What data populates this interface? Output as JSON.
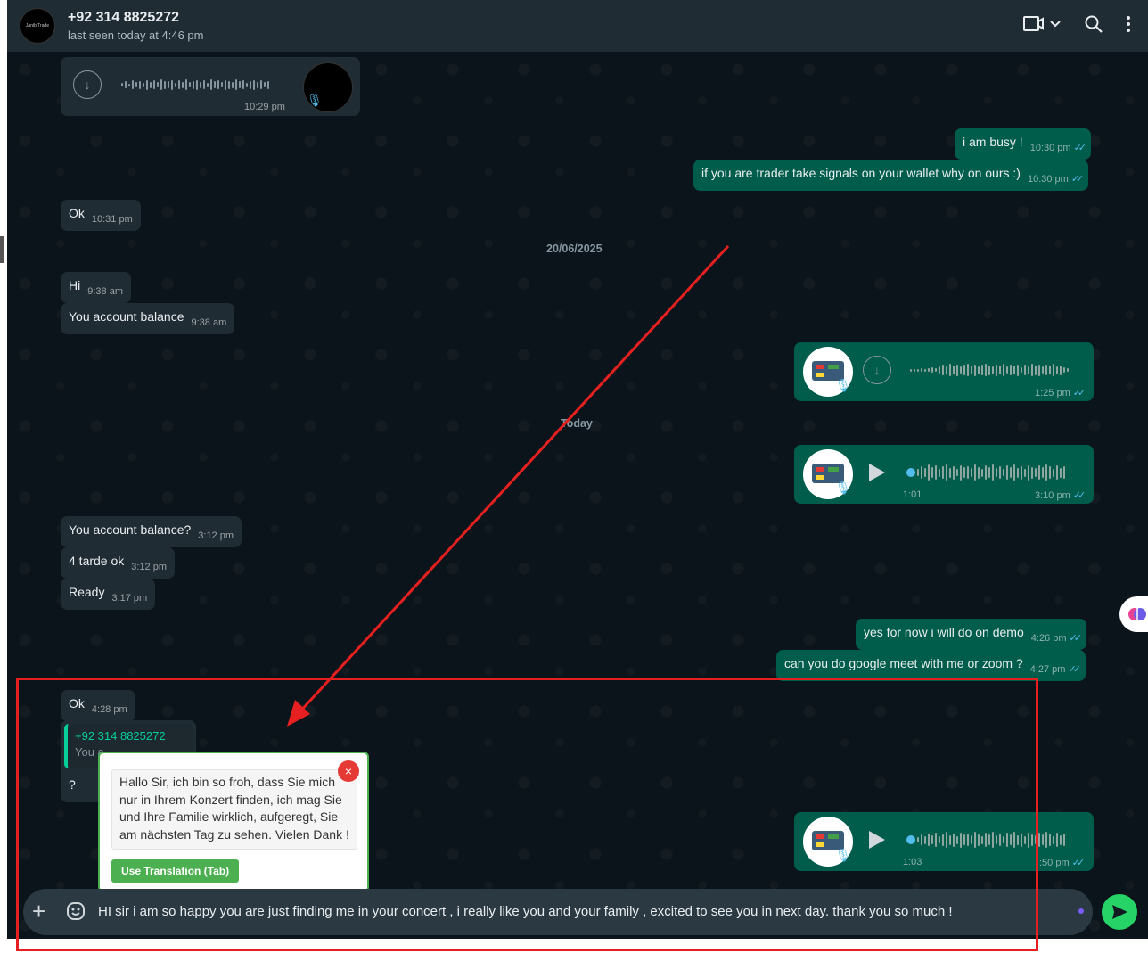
{
  "header": {
    "contact_name": "+92 314 8825272",
    "last_seen": "last seen today at 4:46 pm",
    "avatar_text": "Janib Trade"
  },
  "messages": {
    "voice_in_1": {
      "time": "10:29 pm"
    },
    "out_busy": {
      "text": "i am busy !",
      "time": "10:30 pm"
    },
    "out_trader": {
      "text": "if you are trader take signals on your wallet why on ours :)",
      "time": "10:30 pm"
    },
    "in_ok1": {
      "text": "Ok",
      "time": "10:31 pm"
    },
    "date_divider": "20/06/2025",
    "in_hi": {
      "text": "Hi",
      "time": "9:38 am"
    },
    "in_balance": {
      "text": "You account balance",
      "time": "9:38 am"
    },
    "voice_out_1": {
      "time": "1:25 pm"
    },
    "today_divider": "Today",
    "voice_out_2": {
      "duration": "1:01",
      "time": "3:10 pm"
    },
    "in_balance2": {
      "text": "You account balance?",
      "time": "3:12 pm"
    },
    "in_tarde": {
      "text": "4 tarde ok",
      "time": "3:12 pm"
    },
    "in_ready": {
      "text": "Ready",
      "time": "3:17 pm"
    },
    "out_demo": {
      "text": "yes for now i will do on demo",
      "time": "4:26 pm"
    },
    "out_meet": {
      "text": "can you do google meet with me or zoom ?",
      "time": "4:27 pm"
    },
    "in_ok2": {
      "text": "Ok",
      "time": "4:28 pm"
    },
    "reply": {
      "quoted_name": "+92 314 8825272",
      "quoted_text": "You a",
      "text": "?"
    },
    "voice_out_3": {
      "duration": "1:03",
      "time": ":50 pm"
    }
  },
  "translation_popup": {
    "text": "Hallo Sir, ich bin so froh, dass Sie mich nur in Ihrem Konzert finden, ich mag Sie und Ihre Familie wirklich, aufgeregt, Sie am nächsten Tag zu sehen. Vielen Dank !",
    "close_label": "×",
    "button_label": "Use Translation (Tab)"
  },
  "composer": {
    "text": "HI sir i am so happy you are just finding me in your concert , i really like you and your family , excited to see you in next day. thank you so much !",
    "plus_label": "+"
  },
  "colors": {
    "outgoing_bubble": "#005c4b",
    "incoming_bubble": "#202c33",
    "accent_green": "#25d366",
    "annotation_red": "#e62020"
  }
}
